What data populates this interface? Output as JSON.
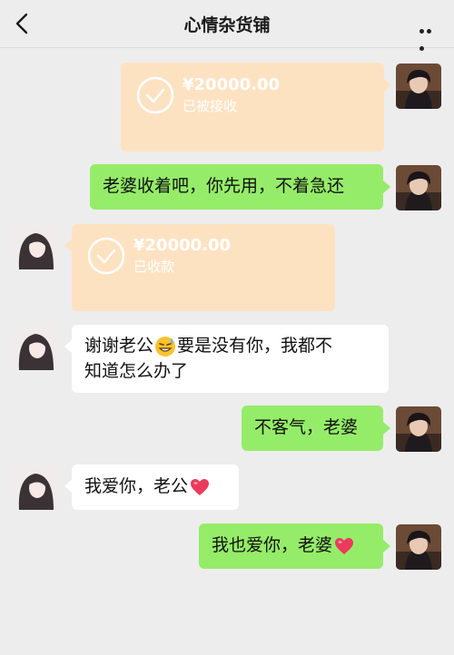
{
  "header": {
    "title": "心情杂货铺"
  },
  "messages": [
    {
      "type": "transfer",
      "side": "right",
      "amount": "¥20000.00",
      "status": "已被接收"
    },
    {
      "type": "text",
      "side": "right",
      "text": "老婆收着吧，你先用，不着急还"
    },
    {
      "type": "transfer",
      "side": "left",
      "amount": "¥20000.00",
      "status": "已收款"
    },
    {
      "type": "text",
      "side": "left",
      "line1": "谢谢老公",
      "line1b": "要是没有你，我都不",
      "line2": "知道怎么办了",
      "emoji": "grinning-sweat-emoji"
    },
    {
      "type": "text",
      "side": "right",
      "text": "不客气，老婆"
    },
    {
      "type": "text",
      "side": "left",
      "text": "我爱你，老公",
      "emoji": "red-heart-emoji"
    },
    {
      "type": "text",
      "side": "right",
      "text": "我也爱你，老婆",
      "emoji": "red-heart-emoji"
    }
  ],
  "colors": {
    "mine": "#95ec69",
    "theirs": "#ffffff",
    "transfer": "#fde2c2",
    "background": "#ededed"
  },
  "icons": [
    "back-arrow-icon",
    "more-icon",
    "check-circle-icon"
  ]
}
